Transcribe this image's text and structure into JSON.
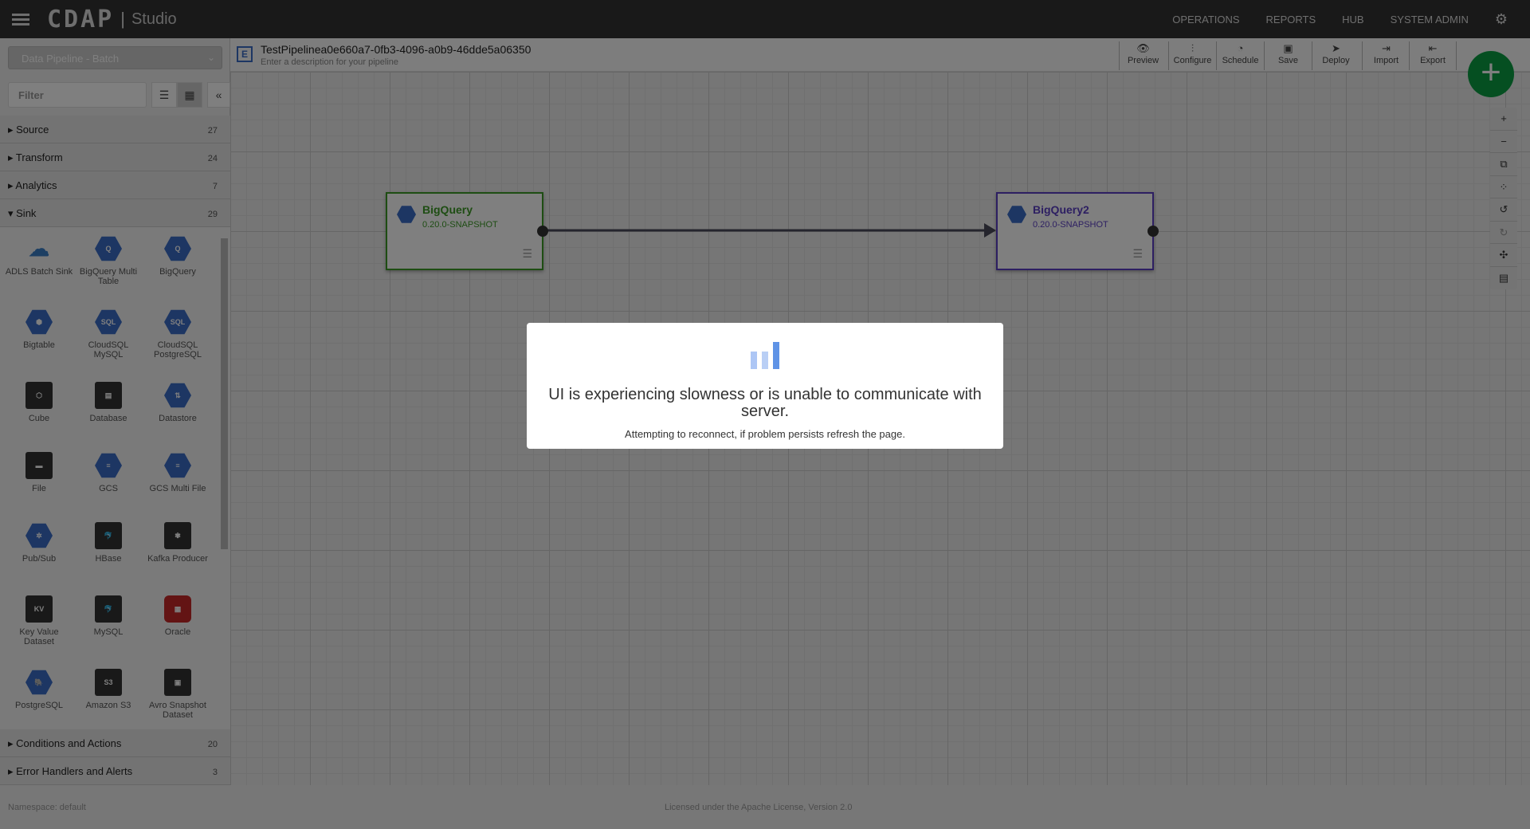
{
  "header": {
    "brand": "CDAP",
    "app": "Studio",
    "nav": [
      "OPERATIONS",
      "REPORTS",
      "HUB",
      "SYSTEM ADMIN"
    ]
  },
  "sidebar": {
    "pipeline_type": "Data Pipeline - Batch",
    "filter_placeholder": "Filter",
    "categories": [
      {
        "label": "Source",
        "count": "27",
        "expanded": false
      },
      {
        "label": "Transform",
        "count": "24",
        "expanded": false
      },
      {
        "label": "Analytics",
        "count": "7",
        "expanded": false
      },
      {
        "label": "Sink",
        "count": "29",
        "expanded": true
      },
      {
        "label": "Conditions and Actions",
        "count": "20",
        "expanded": false
      },
      {
        "label": "Error Handlers and Alerts",
        "count": "3",
        "expanded": false
      }
    ],
    "plugins": [
      "ADLS Batch Sink",
      "BigQuery Multi Table",
      "BigQuery",
      "Bigtable",
      "CloudSQL MySQL",
      "CloudSQL PostgreSQL",
      "Cube",
      "Database",
      "Datastore",
      "File",
      "GCS",
      "GCS Multi File",
      "Pub/Sub",
      "HBase",
      "Kafka Producer",
      "Key Value Dataset",
      "MySQL",
      "Oracle",
      "PostgreSQL",
      "Amazon S3",
      "Avro Snapshot Dataset"
    ]
  },
  "pipeline": {
    "title": "TestPipelinea0e660a7-0fb3-4096-a0b9-46dde5a06350",
    "description_placeholder": "Enter a description for your pipeline"
  },
  "toolbar": [
    "Preview",
    "Configure",
    "Schedule",
    "Save",
    "Deploy",
    "Import",
    "Export"
  ],
  "nodes": [
    {
      "name": "BigQuery",
      "version": "0.20.0-SNAPSHOT",
      "color": "#3c9a27"
    },
    {
      "name": "BigQuery2",
      "version": "0.20.0-SNAPSHOT",
      "color": "#5b3fc4"
    }
  ],
  "footer": {
    "namespace": "Namespace: default",
    "license": "Licensed under the Apache License, Version 2.0"
  },
  "modal": {
    "message": "UI is experiencing slowness or is unable to communicate with server.",
    "sub": "Attempting to reconnect, if problem persists refresh the page."
  }
}
